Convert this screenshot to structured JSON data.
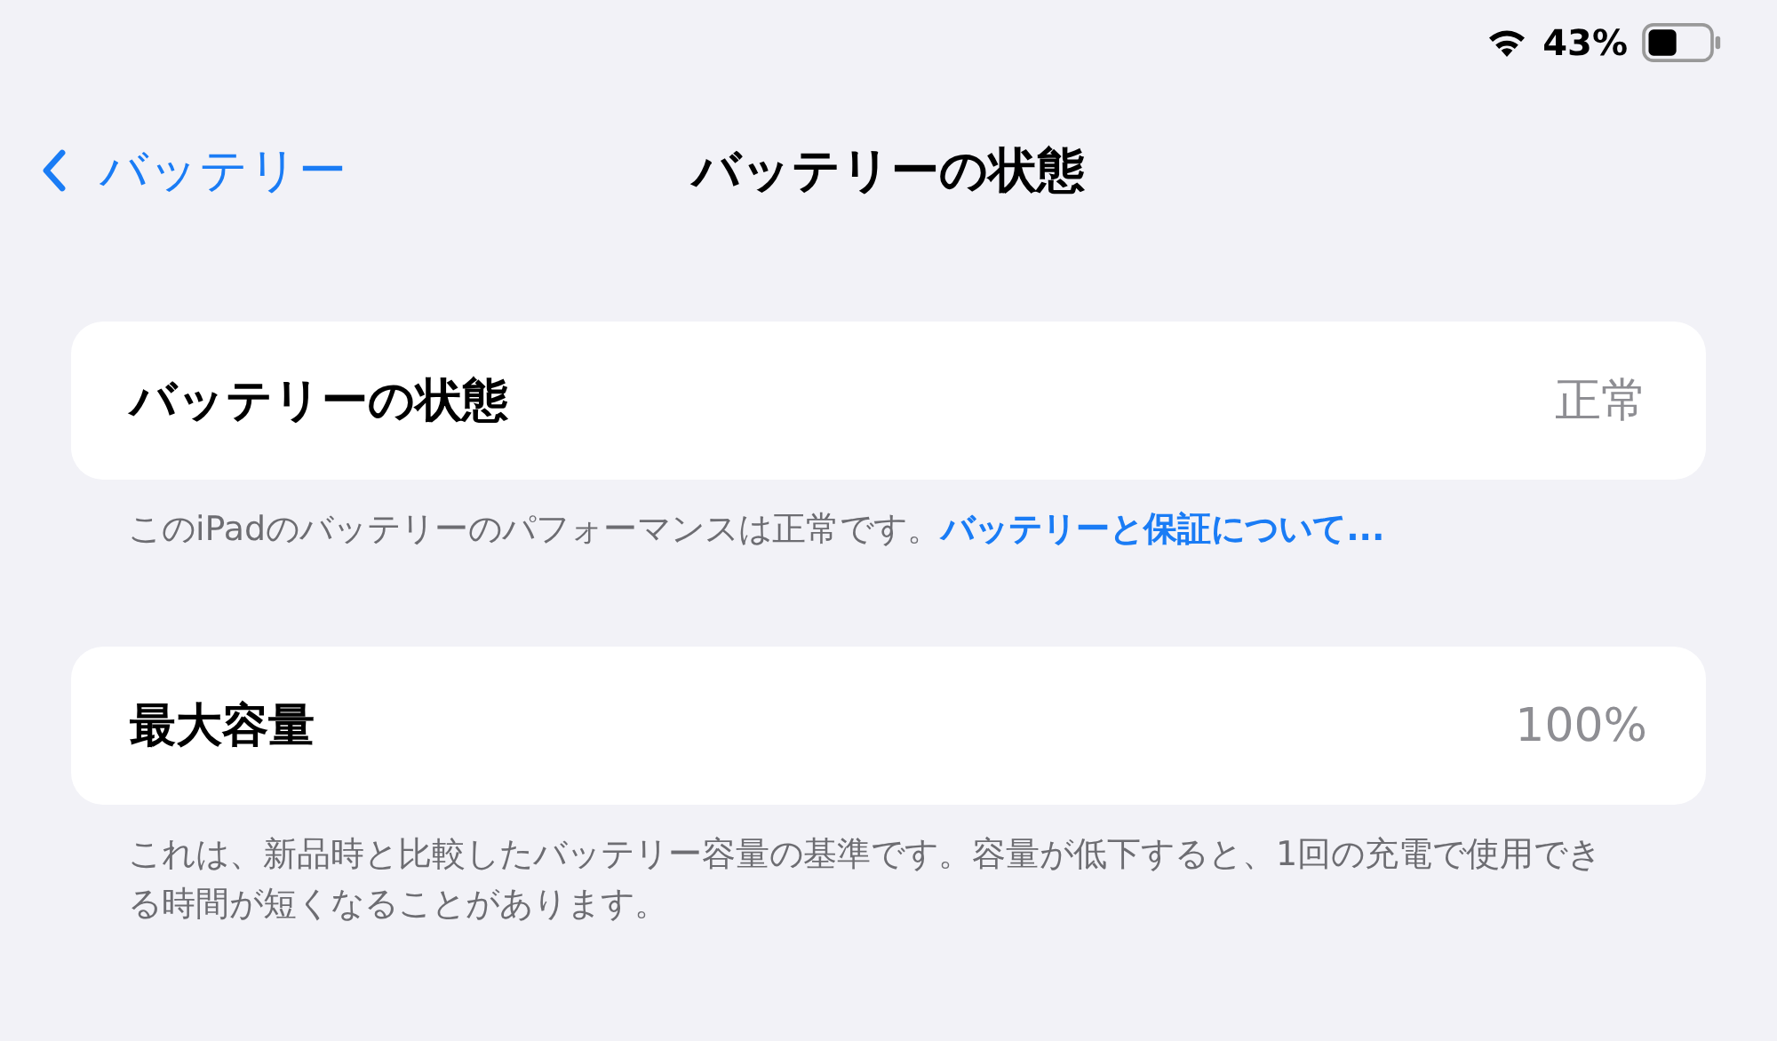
{
  "status_bar": {
    "battery_percent": "43%"
  },
  "nav": {
    "back": "バッテリー",
    "title": "バッテリーの状態"
  },
  "sections": [
    {
      "label": "バッテリーの状態",
      "value": "正常",
      "footnote": "このiPadのバッテリーのパフォーマンスは正常です。",
      "link": "バッテリーと保証について..."
    },
    {
      "label": "最大容量",
      "value": "100%",
      "footnote": "これは、新品時と比較したバッテリー容量の基準です。容量が低下すると、1回の充電で使用できる時間が短くなることがあります。"
    }
  ]
}
